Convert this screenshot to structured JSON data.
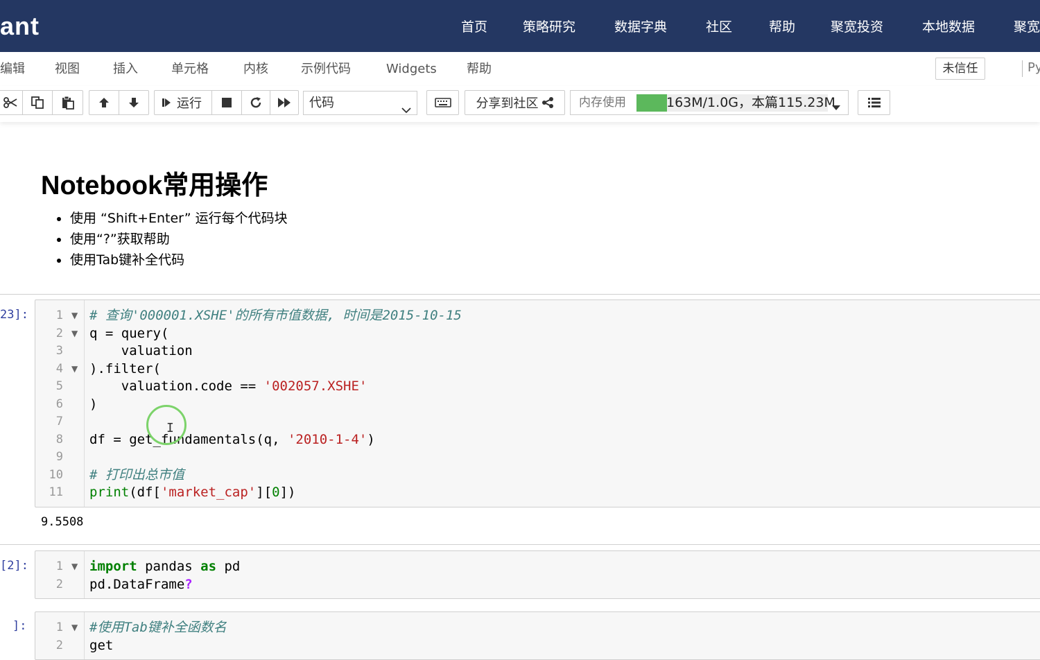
{
  "brand": "ant",
  "nav": [
    "首页",
    "策略研究",
    "数据字典",
    "社区",
    "帮助",
    "聚宽投资",
    "本地数据",
    "聚宽"
  ],
  "menu": [
    "编辑",
    "视图",
    "插入",
    "单元格",
    "内核",
    "示例代码",
    "Widgets",
    "帮助"
  ],
  "trust_label": "未信任",
  "kernel_label": "Py",
  "toolbar": {
    "run_label": "运行",
    "cell_type": "代码",
    "share_label": "分享到社区",
    "memory_label": "内存使用",
    "memory_value": "163M/1.0G，本篇115.23M",
    "memory_fraction": 0.16
  },
  "markdown": {
    "title": "Notebook常用操作",
    "bullets": [
      "使用 “Shift+Enter” 运行每个代码块",
      "使用“?”获取帮助",
      "使用Tab键补全代码"
    ]
  },
  "cells": {
    "c1": {
      "prompt": "23]:",
      "lines": {
        "l1": "# 查询'000001.XSHE'的所有市值数据, 时间是2015-10-15",
        "l2": "q = query(",
        "l3": "    valuation",
        "l4": ").filter(",
        "l5a": "    valuation.code == ",
        "l5b": "'002057.XSHE'",
        "l6": ")",
        "l8a": "df = get_fundamentals(q, ",
        "l8b": "'2010-1-4'",
        "l8c": ")",
        "l10": "# 打印出总市值",
        "l11a": "print",
        "l11b": "(df[",
        "l11c": "'market_cap'",
        "l11d": "][",
        "l11e": "0",
        "l11f": "])"
      },
      "output": "9.5508"
    },
    "c2": {
      "prompt": "[2]:",
      "lines": {
        "l1a": "import",
        "l1b": " pandas ",
        "l1c": "as",
        "l1d": " pd",
        "l2a": "pd.DataFrame",
        "l2b": "?"
      }
    },
    "c3": {
      "prompt": "]:",
      "lines": {
        "l1": "#使用Tab键补全函数名",
        "l2": "get"
      }
    }
  },
  "line_numbers": [
    "1",
    "2",
    "3",
    "4",
    "5",
    "6",
    "7",
    "8",
    "9",
    "10",
    "11"
  ],
  "colors": {
    "nav_bg": "#243762",
    "memory_bar": "#5cb85c",
    "comment": "#408080",
    "string": "#ba2121",
    "keyword": "#008000",
    "prompt": "#303f9f"
  }
}
